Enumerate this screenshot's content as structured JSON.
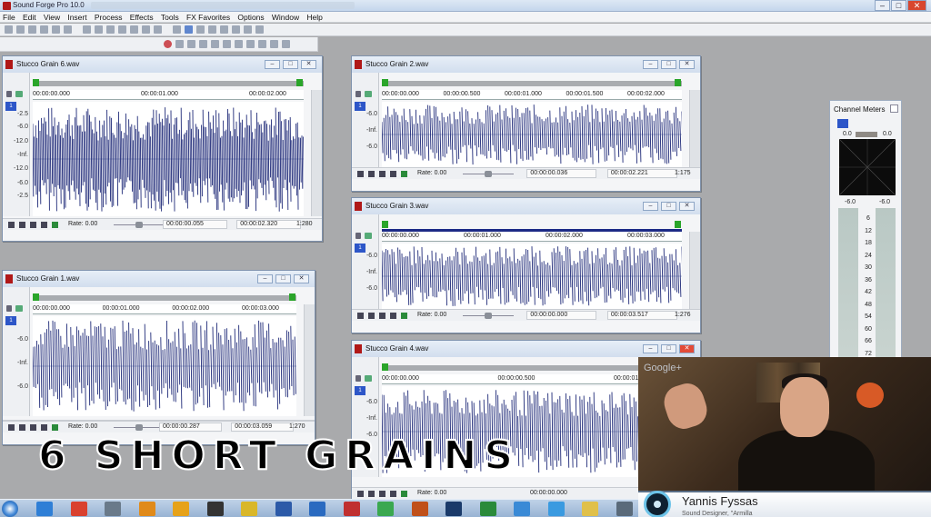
{
  "app": {
    "title": "Sound Forge Pro 10.0",
    "window_controls": [
      "–",
      "□",
      "✕"
    ]
  },
  "menu": [
    "File",
    "Edit",
    "View",
    "Insert",
    "Process",
    "Effects",
    "Tools",
    "FX Favorites",
    "Options",
    "Window",
    "Help"
  ],
  "documents": [
    {
      "name": "Stucco Grain 6.wav",
      "ruler": [
        "00:00:00.000",
        "00:00:01.000",
        "00:00:02.000"
      ],
      "scale": [
        "-2.5",
        "-6.0",
        "-12.0",
        "-Inf.",
        "-12.0",
        "-6.0",
        "-2.5"
      ],
      "rate_label": "Rate: 0.00",
      "pos": "00:00:00.055",
      "length": "00:00:02.320",
      "zoom": "1:280"
    },
    {
      "name": "Stucco Grain 2.wav",
      "ruler": [
        "00:00:00.000",
        "00:00:00.500",
        "00:00:01.000",
        "00:00:01.500",
        "00:00:02.000"
      ],
      "scale": [
        "-6.0",
        "-Inf.",
        "-6.0"
      ],
      "rate_label": "Rate: 0.00",
      "pos": "00:00:00.036",
      "length": "00:00:02.221",
      "zoom": "1:175"
    },
    {
      "name": "Stucco Grain 3.wav",
      "ruler": [
        "00:00:00.000",
        "00:00:01.000",
        "00:00:02.000",
        "00:00:03.000"
      ],
      "scale": [
        "-6.0",
        "-Inf.",
        "-6.0"
      ],
      "rate_label": "Rate: 0.00",
      "pos": "00:00:00.000",
      "length": "00:00:03.517",
      "zoom": "1:276"
    },
    {
      "name": "Stucco Grain 1.wav",
      "ruler": [
        "00:00:00.000",
        "00:00:01.000",
        "00:00:02.000",
        "00:00:03.000"
      ],
      "scale": [
        "-6.0",
        "-Inf.",
        "-6.0"
      ],
      "rate_label": "Rate: 0.00",
      "pos": "00:00:00.287",
      "length": "00:00:03.059",
      "zoom": "1:270"
    },
    {
      "name": "Stucco Grain 4.wav",
      "ruler": [
        "00:00:00.000",
        "00:00:00.500",
        "00:00:01.000"
      ],
      "scale": [
        "-6.0",
        "-Inf.",
        "-6.0"
      ],
      "rate_label": "Rate: 0.00",
      "pos": "00:00:00.000",
      "length": ""
    }
  ],
  "channel_meters": {
    "title": "Channel Meters",
    "peak_left": "0.0",
    "peak_right": "0.0",
    "level_left": "-6.0",
    "level_right": "-6.0",
    "scale": [
      "6",
      "12",
      "18",
      "24",
      "30",
      "36",
      "42",
      "48",
      "54",
      "60",
      "66",
      "72"
    ]
  },
  "overlay_caption": "6 SHORT GRAINS",
  "webcam": {
    "logo": "Google+",
    "name": "Yannis Fyssas",
    "subtitle": "Sound Designer, \"Armilla"
  },
  "colors": {
    "waveform": "#1f2a78",
    "waveform_bg": "#ffffff",
    "titlebar": "#c4d6ec",
    "selection_bar": "#1c2a86"
  },
  "icons": [
    "app-icon",
    "new-icon",
    "open-icon",
    "save-icon",
    "cut-icon",
    "copy-icon",
    "paste-icon",
    "undo-icon",
    "redo-icon",
    "record-icon",
    "play-icon",
    "stop-icon",
    "pause-icon",
    "rewind-icon",
    "forward-icon",
    "lock-icon"
  ]
}
